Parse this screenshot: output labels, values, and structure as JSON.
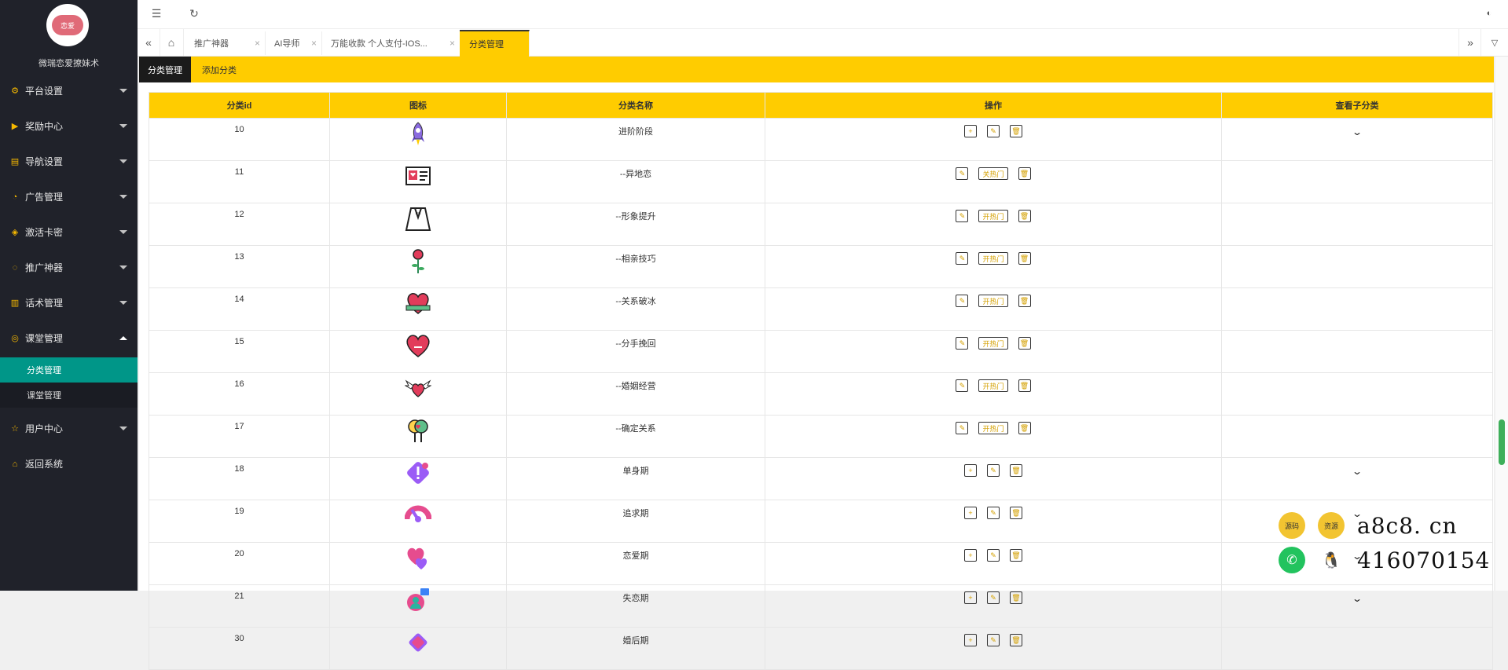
{
  "sidebar": {
    "logo_text": "恋爱",
    "brand": "微瑞恋爱撩妹术",
    "items": [
      {
        "label": "平台设置",
        "icon": "gear-icon"
      },
      {
        "label": "奖励中心",
        "icon": "play-icon"
      },
      {
        "label": "导航设置",
        "icon": "book-icon"
      },
      {
        "label": "广告管理",
        "icon": "gauge-icon"
      },
      {
        "label": "激活卡密",
        "icon": "cube-icon"
      },
      {
        "label": "推广神器",
        "icon": "chat-icon"
      },
      {
        "label": "话术管理",
        "icon": "doc-icon"
      },
      {
        "label": "课堂管理",
        "icon": "glasses-icon"
      },
      {
        "label": "用户中心",
        "icon": "star-icon"
      },
      {
        "label": "返回系统",
        "icon": "home-icon"
      }
    ],
    "sub_items": [
      {
        "label": "分类管理",
        "active": true
      },
      {
        "label": "课堂管理",
        "active": false
      }
    ]
  },
  "tabs": [
    {
      "label": "推广神器"
    },
    {
      "label": "AI导师"
    },
    {
      "label": "万能收款 个人支付-IOS..."
    },
    {
      "label": "分类管理",
      "active": true
    }
  ],
  "sub_tabs": [
    "分类管理",
    "添加分类"
  ],
  "table": {
    "headers": [
      "分类id",
      "图标",
      "分类名称",
      "操作",
      "查看子分类"
    ],
    "rows": [
      {
        "id": "10",
        "icon": "rocket-icon",
        "name": "进阶阶段",
        "hot": "",
        "has_add": true,
        "expand": true
      },
      {
        "id": "11",
        "icon": "id-card-icon",
        "name": "--异地恋",
        "hot": "关热门",
        "has_add": false,
        "expand": false
      },
      {
        "id": "12",
        "icon": "suit-icon",
        "name": "--形象提升",
        "hot": "开热门",
        "has_add": false,
        "expand": false
      },
      {
        "id": "13",
        "icon": "rose-icon",
        "name": "--相亲技巧",
        "hot": "开热门",
        "has_add": false,
        "expand": false
      },
      {
        "id": "14",
        "icon": "heart-ribbon-icon",
        "name": "--关系破冰",
        "hot": "开热门",
        "has_add": false,
        "expand": false
      },
      {
        "id": "15",
        "icon": "heart-sad-icon",
        "name": "--分手挽回",
        "hot": "开热门",
        "has_add": false,
        "expand": false
      },
      {
        "id": "16",
        "icon": "heart-wings-icon",
        "name": "--婚姻经营",
        "hot": "开热门",
        "has_add": false,
        "expand": false
      },
      {
        "id": "17",
        "icon": "lollipop-icon",
        "name": "--确定关系",
        "hot": "开热门",
        "has_add": false,
        "expand": false
      },
      {
        "id": "18",
        "icon": "alert-diamond-icon",
        "name": "单身期",
        "hot": "",
        "has_add": true,
        "expand": true
      },
      {
        "id": "19",
        "icon": "gauge-icon",
        "name": "追求期",
        "hot": "",
        "has_add": true,
        "expand": true
      },
      {
        "id": "20",
        "icon": "hearts-icon",
        "name": "恋爱期",
        "hot": "",
        "has_add": true,
        "expand": true
      },
      {
        "id": "21",
        "icon": "user-chat-icon",
        "name": "失恋期",
        "hot": "",
        "has_add": true,
        "expand": true
      },
      {
        "id": "30",
        "icon": "layers-icon",
        "name": "婚后期",
        "hot": "",
        "has_add": true,
        "expand": false
      }
    ]
  },
  "watermark": {
    "site": "a8c8. cn",
    "qq": "416070154",
    "badge1": "源码",
    "badge2": "资源"
  },
  "colors": {
    "sidebar_bg": "#20222a",
    "accent_yellow": "#ffcc00",
    "active_sub": "#009688"
  }
}
